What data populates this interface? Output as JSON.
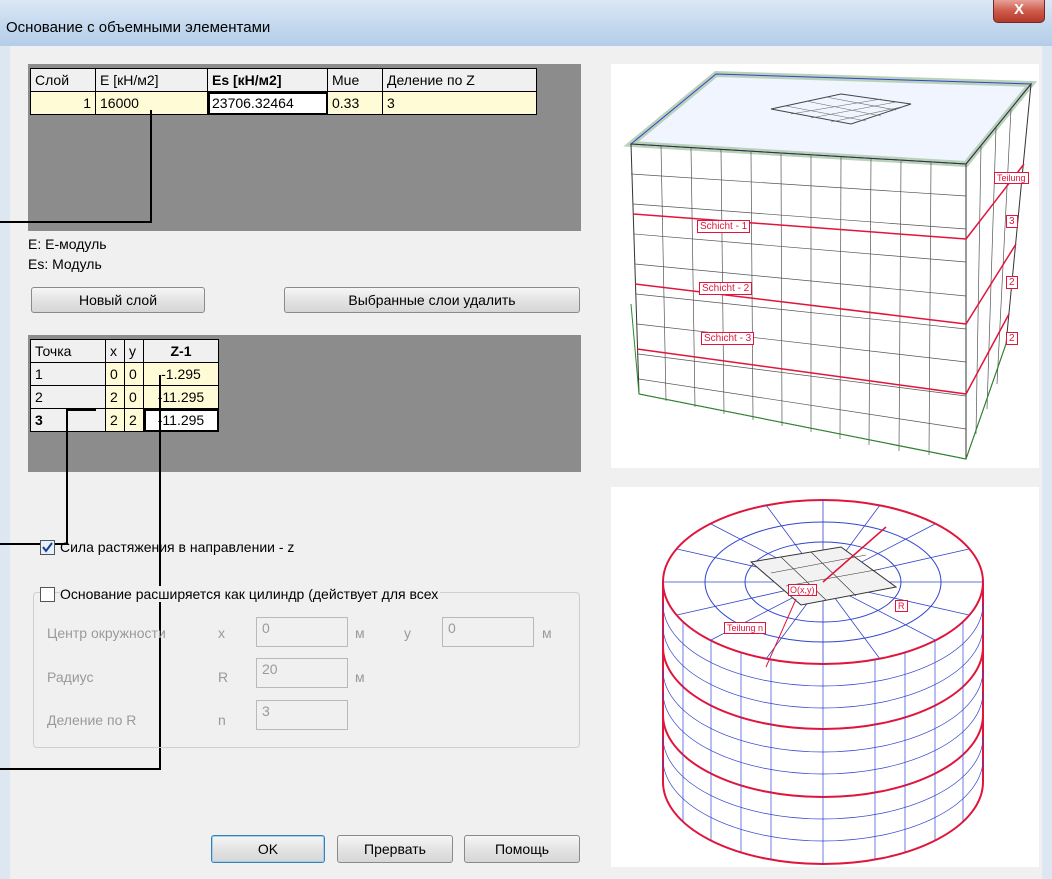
{
  "window": {
    "title": "Основание с объемными элементами",
    "close_glyph": "X"
  },
  "layers_table": {
    "headers": [
      "Слой",
      "E [кН/м2]",
      "Es [кН/м2]",
      "Mue",
      "Деление по Z"
    ],
    "rows": [
      {
        "layer": "1",
        "e": "16000",
        "es": "23706.32464",
        "mue": "0.33",
        "div_z": "3"
      }
    ]
  },
  "legend": {
    "e_line": "E: E-модуль",
    "es_line": "Es: Модуль"
  },
  "buttons": {
    "new_layer": "Новый слой",
    "delete_layers": "Выбранные слои  удалить",
    "ok": "OK",
    "cancel": "Прервать",
    "help": "Помощь"
  },
  "points_table": {
    "headers": [
      "Точка",
      "x",
      "y",
      "Z-1"
    ],
    "rows": [
      {
        "point": "1",
        "x": "0",
        "y": "0",
        "z": "-1.295"
      },
      {
        "point": "2",
        "x": "2",
        "y": "0",
        "z": "-11.295"
      },
      {
        "point": "3",
        "x": "2",
        "y": "2",
        "z": "-11.295"
      }
    ]
  },
  "options": {
    "tension_z": {
      "label": "Сила растяжения в направлении - z",
      "checked": true
    },
    "cylinder": {
      "label": "Основание расширяется как цилиндр (действует для всех",
      "checked": false
    }
  },
  "cylinder_fields": {
    "center_label": "Центр окружности",
    "x_label": "x",
    "x_value": "0",
    "x_unit": "м",
    "y_label": "y",
    "y_value": "0",
    "y_unit": "м",
    "radius_label": "Радиус",
    "r_label": "R",
    "r_value": "20",
    "r_unit": "м",
    "division_label": "Деление по R",
    "n_label": "n",
    "n_value": "3"
  },
  "box_image": {
    "teilung": "Teilung",
    "schicht1": "Schicht - 1",
    "schicht2": "Schicht - 2",
    "schicht3": "Schicht - 3",
    "div1": "3",
    "div2": "2",
    "div3": "2"
  },
  "cyl_image": {
    "center": "O(x,y)",
    "radius": "R",
    "teilung": "Teilung n"
  },
  "colors": {
    "accent": "#ff0000",
    "mesh": "#0000cc",
    "grid_cell": "#fffbd6"
  }
}
